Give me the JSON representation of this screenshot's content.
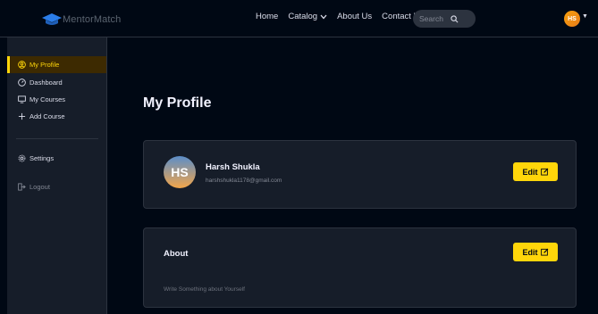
{
  "brand": {
    "name": "MentorMatch"
  },
  "nav": {
    "links": [
      "Home",
      "Catalog",
      "About Us",
      "Contact Us"
    ],
    "search_placeholder": "Search",
    "avatar_initials": "HS"
  },
  "sidebar": {
    "items": [
      {
        "label": "My Profile",
        "icon": "user-circle-icon"
      },
      {
        "label": "Dashboard",
        "icon": "gauge-icon"
      },
      {
        "label": "My Courses",
        "icon": "monitor-icon"
      },
      {
        "label": "Add Course",
        "icon": "plus-icon"
      }
    ],
    "settings_label": "Settings",
    "logout_label": "Logout"
  },
  "main": {
    "title": "My Profile",
    "profile": {
      "initials": "HS",
      "name": "Harsh Shukla",
      "email": "harshshukla1178@gmail.com",
      "edit_label": "Edit"
    },
    "about": {
      "title": "About",
      "placeholder_text": "Write Something about Yourself",
      "edit_label": "Edit"
    }
  },
  "colors": {
    "accent": "#ffd60a",
    "background": "#000814",
    "card": "#161d29",
    "active_bg": "#3d2a01"
  }
}
